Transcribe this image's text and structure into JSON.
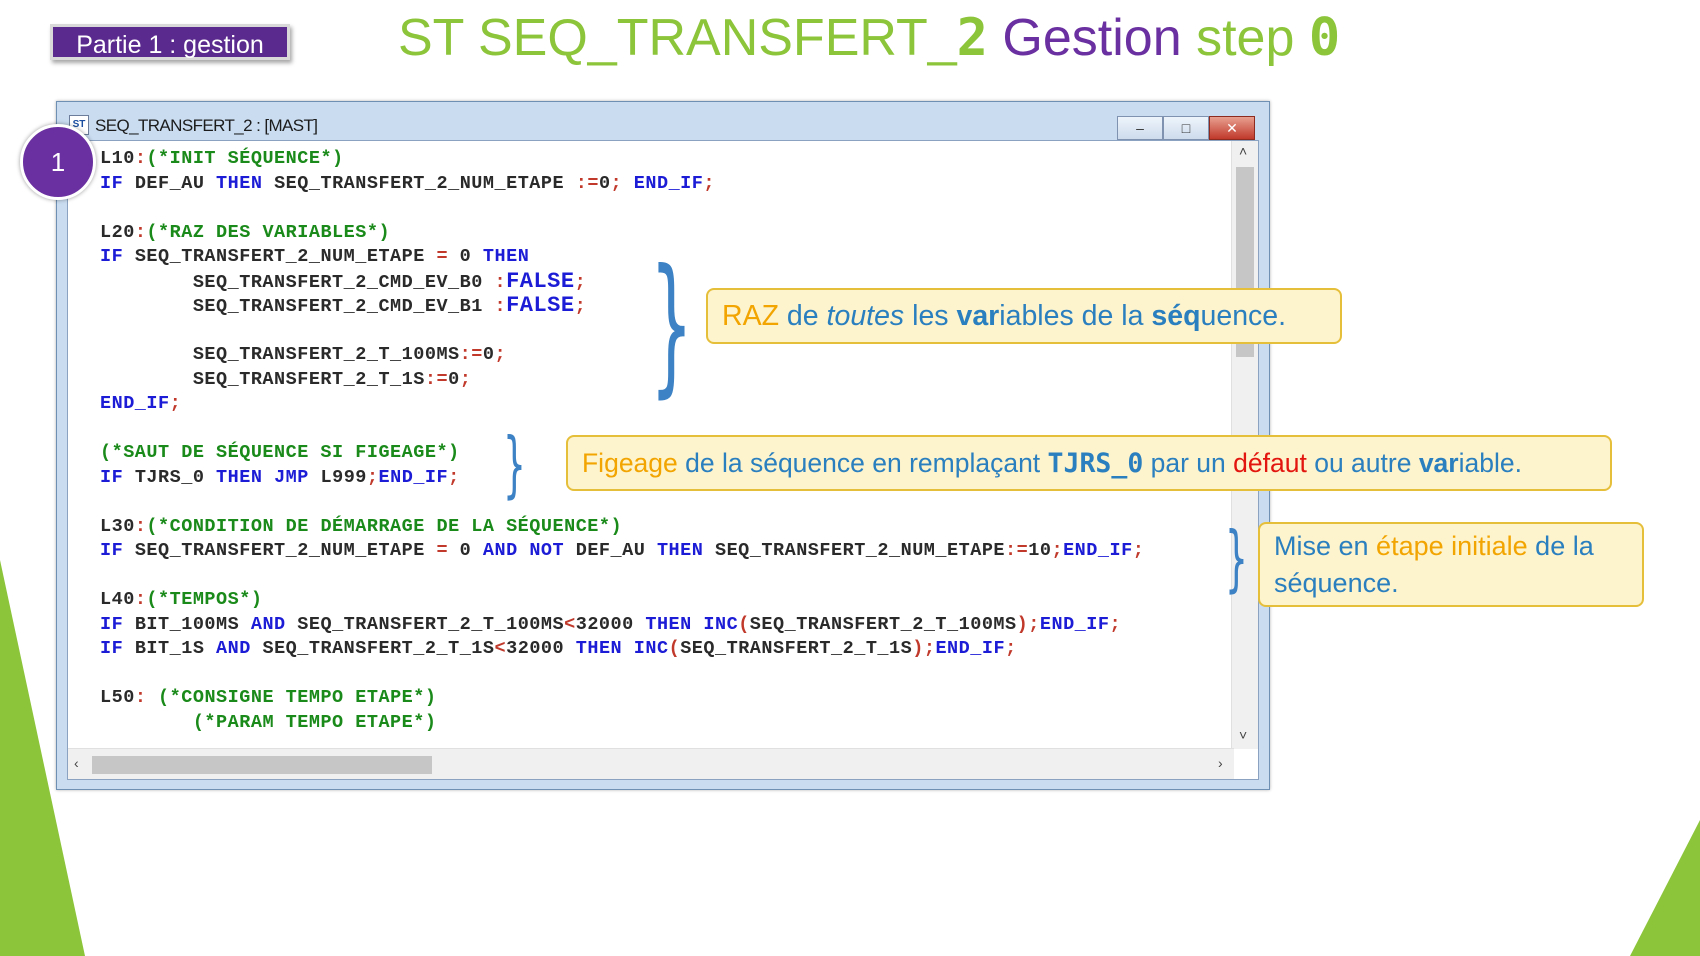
{
  "badge": "Partie 1 : gestion",
  "title": {
    "prefix": "ST SEQ_TRANSFERT_",
    "num": "2",
    "gestion": " Gestion",
    "step": " step ",
    "zero": "0"
  },
  "window": {
    "icon": "ST",
    "title": "SEQ_TRANSFERT_2 : [MAST]",
    "minimize_icon": "minimize-icon",
    "maximize_icon": "maximize-icon",
    "close_icon": "close-icon"
  },
  "step_number": "1",
  "code_lines": [
    "L10:(*INIT SÉQUENCE*)",
    "IF DEF_AU THEN SEQ_TRANSFERT_2_NUM_ETAPE :=0; END_IF;",
    "",
    "L20:(*RAZ DES VARIABLES*)",
    "IF SEQ_TRANSFERT_2_NUM_ETAPE = 0 THEN",
    "        SEQ_TRANSFERT_2_CMD_EV_B0 :FALSE;",
    "        SEQ_TRANSFERT_2_CMD_EV_B1 :FALSE;",
    "",
    "        SEQ_TRANSFERT_2_T_100MS:=0;",
    "        SEQ_TRANSFERT_2_T_1S:=0;",
    "END_IF;",
    "",
    "(*SAUT DE SÉQUENCE SI FIGEAGE*)",
    "IF TJRS_0 THEN JMP L999;END_IF;",
    "",
    "L30:(*CONDITION DE DÉMARRAGE DE LA SÉQUENCE*)",
    "IF SEQ_TRANSFERT_2_NUM_ETAPE = 0 AND NOT DEF_AU THEN SEQ_TRANSFERT_2_NUM_ETAPE:=10;END_IF;",
    "",
    "L40:(*TEMPOS*)",
    "IF BIT_100MS AND SEQ_TRANSFERT_2_T_100MS<32000 THEN INC(SEQ_TRANSFERT_2_T_100MS);END_IF;",
    "IF BIT_1S AND SEQ_TRANSFERT_2_T_1S<32000 THEN INC(SEQ_TRANSFERT_2_T_1S);END_IF;",
    "",
    "L50: (*CONSIGNE TEMPO ETAPE*)",
    "        (*PARAM TEMPO ETAPE*)"
  ],
  "notes": {
    "raz": {
      "w1": "RAZ",
      "w2": " de ",
      "w3": "toutes",
      "w4": " les ",
      "w5": "var",
      "w6": "iables de la ",
      "w7": "séq",
      "w8": "uence."
    },
    "figeage": {
      "w1": "Figeage",
      "w2": " de la séquence en remplaçant ",
      "w3": "TJRS_0",
      "w4": " par un ",
      "w5": "défaut",
      "w6": " ou autre ",
      "w7": "var",
      "w8": "iable."
    },
    "mise": {
      "w1": "Mise en ",
      "w2": "étape initiale",
      "w3": " de la",
      "w4": "séquence."
    }
  },
  "colors": {
    "green": "#8cc43a",
    "purple": "#6a2fa0",
    "keyword": "#1c1cd6",
    "comment": "#1a8a1a",
    "operator": "#c0392b",
    "note_bg": "#fdf3cc",
    "note_text": "#2a7fbf",
    "note_orange": "#f2a400"
  }
}
